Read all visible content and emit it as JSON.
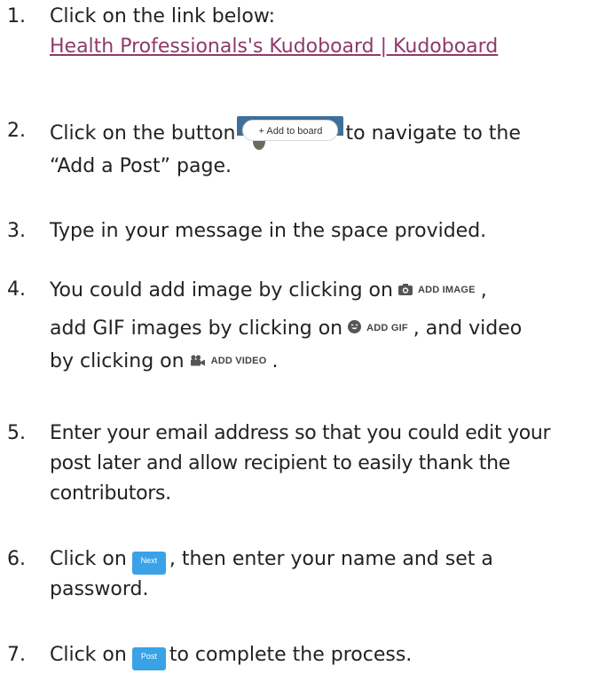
{
  "steps": [
    {
      "number": "1.",
      "line1": "Click on the link below:",
      "link_text": "Health Professionals's Kudoboard | Kudoboard"
    },
    {
      "number": "2.",
      "before": "Click on the button",
      "button_label": "+ Add to board",
      "after": "to navigate to the",
      "line2": "“Add a Post” page."
    },
    {
      "number": "3.",
      "line1": "Type in your message in the space provided."
    },
    {
      "number": "4.",
      "line1_before": "You could add image by clicking on",
      "add_image_label": "ADD IMAGE",
      "line1_after": ",",
      "line2_before": "add GIF images by clicking on",
      "add_gif_label": "ADD GIF",
      "line2_after": ", and video",
      "line3_before": "by clicking on",
      "add_video_label": "ADD VIDEO",
      "line3_after": "."
    },
    {
      "number": "5.",
      "line1": "Enter your email address so that you could edit your",
      "line2": "post later and allow recipient to easily thank the",
      "line3": "contributors."
    },
    {
      "number": "6.",
      "before": "Click on",
      "button_label": "Next",
      "after": ", then enter your name and set a",
      "line2": "password."
    },
    {
      "number": "7.",
      "before": "Click on",
      "button_label": "Post",
      "after": "to complete the process."
    }
  ],
  "colors": {
    "link": "#8e3a6a",
    "blue_button": "#3aa2e6"
  },
  "icons": [
    "camera-icon",
    "smiley-icon",
    "video-camera-icon"
  ]
}
